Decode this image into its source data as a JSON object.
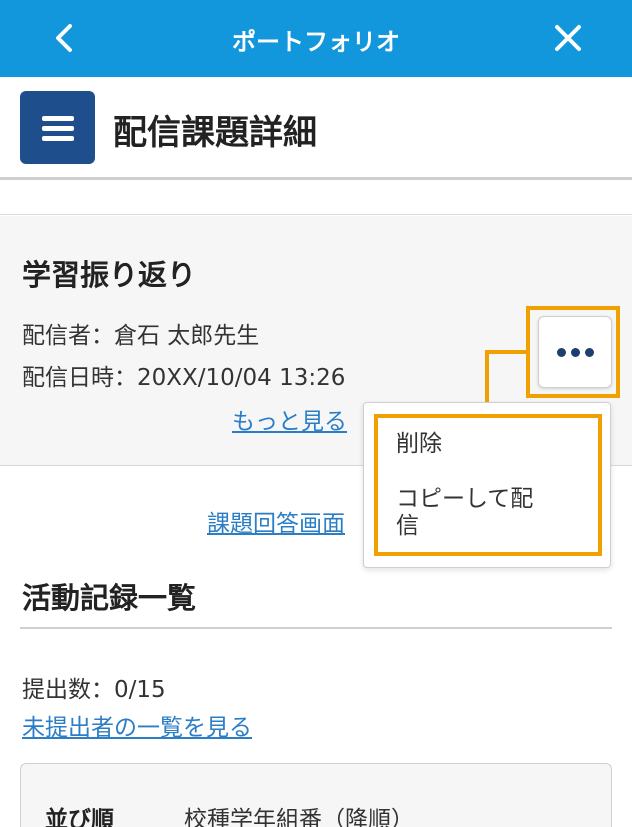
{
  "topbar": {
    "title": "ポートフォリオ"
  },
  "header": {
    "title": "配信課題詳細"
  },
  "assignment": {
    "title": "学習振り返り",
    "sender": "配信者：倉石 太郎先生",
    "datetime": "配信日時：20XX/10/04 13:26",
    "more_link": "もっと見る"
  },
  "popup_menu": {
    "items": [
      {
        "label": "削除"
      },
      {
        "label": "コピーして配\n信"
      }
    ]
  },
  "answer_screen_link": "課題回答画面",
  "activity": {
    "title": "活動記録一覧",
    "count": "提出数：0/15",
    "unsubmitted_link": "未提出者の一覧を見る",
    "sort": {
      "label": "並び順",
      "value": "校種学年組番（降順）"
    }
  },
  "colors": {
    "topbar": "#1397dc",
    "menu_button": "#1f4e8c",
    "highlight": "#f0a000",
    "link": "#2b7ec6"
  },
  "icons": [
    "back-icon",
    "close-icon",
    "menu-icon",
    "more-dots-icon"
  ]
}
